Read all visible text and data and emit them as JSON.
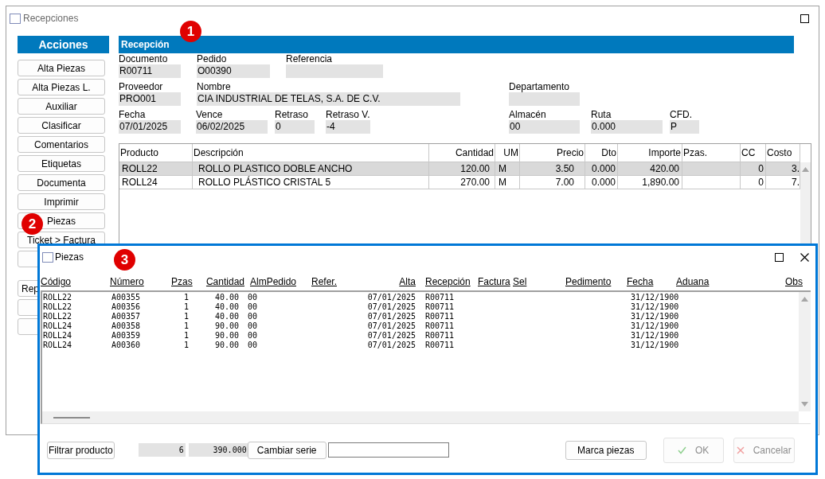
{
  "main_window": {
    "title": "Recepciones"
  },
  "actions": {
    "title": "Acciones",
    "buttons": [
      {
        "label": "Alta Piezas"
      },
      {
        "label": "Alta Piezas L."
      },
      {
        "label": "Auxiliar"
      },
      {
        "label": "Clasificar"
      },
      {
        "label": "Comentarios"
      },
      {
        "label": "Etiquetas"
      },
      {
        "label": "Documenta"
      },
      {
        "label": "Imprimir"
      },
      {
        "label": "Piezas",
        "marker": "2"
      },
      {
        "label": "Ticket > Factura"
      }
    ],
    "lower_buttons": [
      {
        "label": "Rep"
      }
    ]
  },
  "reception": {
    "title": "Recepción",
    "marker": "1",
    "fields": [
      {
        "label": "Documento",
        "value": "R00711"
      },
      {
        "label": "Pedido",
        "value": "O00390"
      },
      {
        "label": "Referencia"
      },
      {
        "label": "Proveedor",
        "value": "PRO001"
      },
      {
        "label": "Nombre",
        "value": "CIA INDUSTRIAL DE TELAS, S.A. DE C.V."
      },
      {
        "label": "Departamento"
      },
      {
        "label": "Fecha",
        "value": "07/01/2025"
      },
      {
        "label": "Vence",
        "value": "06/02/2025"
      },
      {
        "label": "Retraso",
        "value": "0"
      },
      {
        "label": "Retraso V.",
        "value": "-4"
      },
      {
        "label": "Almacén",
        "value": "00"
      },
      {
        "label": "Ruta",
        "value": "0.000"
      },
      {
        "label": "CFD.",
        "value": "P"
      }
    ]
  },
  "table": {
    "columns": [
      "Producto",
      "Descripción",
      "Cantidad",
      "UM",
      "Precio",
      "Dto",
      "Importe",
      "Pzas.",
      "CC",
      "Costo"
    ],
    "rows": [
      {
        "selected": true,
        "cells": [
          "ROLL22",
          "ROLLO PLASTICO DOBLE ANCHO",
          "120.00",
          "M",
          "3.50",
          "0.000",
          "420.00",
          null,
          "0",
          "3."
        ]
      },
      {
        "selected": false,
        "cells": [
          "ROLL24",
          "ROLLO PLÁSTICO CRISTAL 5",
          "270.00",
          "M",
          "7.00",
          "0.000",
          "1,890.00",
          null,
          "0",
          "7."
        ]
      }
    ]
  },
  "dialog": {
    "title": "Piezas",
    "marker": "3",
    "columns": [
      "Código",
      "Número",
      "Pzas",
      "Cantidad",
      "AlmPedido",
      "Refer.",
      "Alta",
      "Recepción",
      "Factura",
      "Sel",
      "Pedimento",
      "Fecha",
      "Aduana",
      "Obs"
    ],
    "rows": [
      [
        "ROLL22",
        "A00355",
        "1",
        "40.00",
        "00",
        null,
        "07/01/2025",
        "R00711",
        null,
        null,
        null,
        "31/12/1900"
      ],
      [
        "ROLL22",
        "A00356",
        "1",
        "40.00",
        "00",
        null,
        "07/01/2025",
        "R00711",
        null,
        null,
        null,
        "31/12/1900"
      ],
      [
        "ROLL22",
        "A00357",
        "1",
        "40.00",
        "00",
        null,
        "07/01/2025",
        "R00711",
        null,
        null,
        null,
        "31/12/1900"
      ],
      [
        "ROLL24",
        "A00358",
        "1",
        "90.00",
        "00",
        null,
        "07/01/2025",
        "R00711",
        null,
        null,
        null,
        "31/12/1900"
      ],
      [
        "ROLL24",
        "A00359",
        "1",
        "90.00",
        "00",
        null,
        "07/01/2025",
        "R00711",
        null,
        null,
        null,
        "31/12/1900"
      ],
      [
        "ROLL24",
        "A00360",
        "1",
        "90.00",
        "00",
        null,
        "07/01/2025",
        "R00711",
        null,
        null,
        null,
        "31/12/1900"
      ]
    ],
    "footer": {
      "filter_button": "Filtrar producto",
      "count": "6",
      "total": "390.000",
      "series_button": "Cambiar serie",
      "mark_button": "Marca piezas",
      "ok": {
        "label": "OK",
        "disabled": true
      },
      "cancel": {
        "label": "Cancelar",
        "disabled": true
      }
    }
  }
}
